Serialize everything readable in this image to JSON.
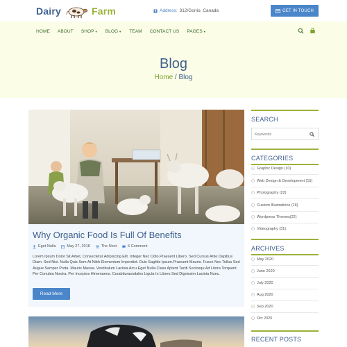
{
  "brand": {
    "word1": "Dairy",
    "word2": "Farm"
  },
  "topbar": {
    "address_label": "Address:",
    "address_value": "312/Gonio, Canada",
    "cta_label": "GET IN TOUCH"
  },
  "nav": {
    "items": [
      {
        "label": "HOME",
        "dropdown": false
      },
      {
        "label": "ABOUT",
        "dropdown": false
      },
      {
        "label": "SHOP",
        "dropdown": true
      },
      {
        "label": "BLOG",
        "dropdown": true
      },
      {
        "label": "TEAM",
        "dropdown": false
      },
      {
        "label": "CONTACT US",
        "dropdown": false
      },
      {
        "label": "PAGES",
        "dropdown": true
      }
    ],
    "icons": [
      "search-icon",
      "cart-icon"
    ]
  },
  "hero": {
    "title": "Blog",
    "breadcrumb_home": "Home",
    "breadcrumb_sep": " / ",
    "breadcrumb_current": "Blog"
  },
  "posts": [
    {
      "title": "Why Organic Food Is Full Of Benefits",
      "author": "Eget Nulla",
      "date": "May 27, 2018",
      "category": "The Nest",
      "comments": "6 Comment",
      "excerpt": "Lorem Ipsum Dolor Sit Amet, Consectetur Adipiscing Elit. Integer Nec Odio.Praesent Libero. Sed Cursus Ante Dapibus Diam. Sed Nisi. Nulla Quis Sem At Nibh Elementum Imperdiet. Duis Sagittis Ipsum.Praesent Mauris. Fusce Nec Tellus Sed Augue Semper Porta. Mauris Massa. Vestibulum Lacinia Arcu Eget Nulla.Class Aptent Taciti Sociosqu Ad Litora Torquent Per Conubia Nostra, Per Inceptos Himenaeos. Curabiturasodales Ligula In Libero.Sed Dignissim Lacinia Nunc.",
      "read_more": "Read More"
    }
  ],
  "sidebar": {
    "search": {
      "title": "SEARCH",
      "placeholder": "Keywords"
    },
    "categories": {
      "title": "CATEGORIES",
      "items": [
        "Graphic Design (10)",
        "Web Design & Development (15)",
        "Photography (22)",
        "Custom Illustrations (16)",
        "Wordpress Themes(22)",
        "Videography (31)"
      ]
    },
    "archives": {
      "title": "ARCHIVES",
      "items": [
        "May 2020",
        "June 2020",
        "July 2020",
        "Aug 2020",
        "Sep 2020",
        "Oct 2020"
      ]
    },
    "recent_posts": {
      "title": "RECENT POSTS"
    }
  },
  "colors": {
    "primary_blue": "#3f5f8f",
    "button_blue": "#4a86c9",
    "accent_green": "#9bb23c",
    "nav_green": "#3a6b2c",
    "light_bg": "#fbfde6",
    "card_bg": "#f1f7fc"
  }
}
